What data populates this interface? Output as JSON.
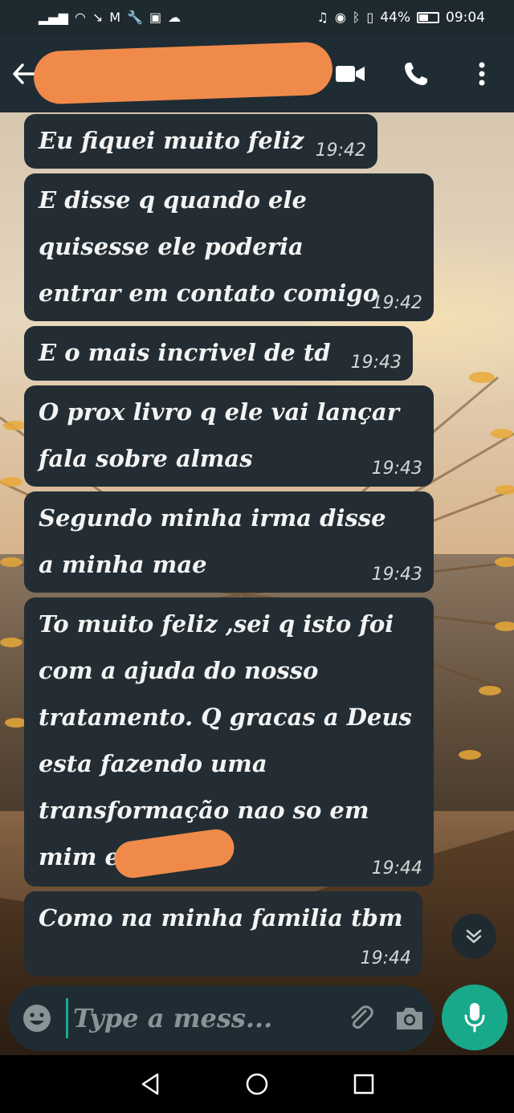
{
  "status_bar": {
    "battery_percent": "44%",
    "battery_level": 0.44,
    "time": "09:04"
  },
  "header": {
    "contact_name": "",
    "icons": {
      "back": "back-arrow-icon",
      "video": "video-call-icon",
      "call": "phone-call-icon",
      "menu": "more-options-icon"
    }
  },
  "messages": [
    {
      "text": "Eu fiquei muito feliz",
      "time": "19:42"
    },
    {
      "text": "E disse q quando ele quisesse ele poderia entrar em contato comigo sim",
      "time": "19:42"
    },
    {
      "text": "E o mais incrivel de td",
      "time": "19:43"
    },
    {
      "text": "O prox livro q ele vai lançar fala sobre almas",
      "time": "19:43"
    },
    {
      "text": "Segundo minha irma disse a minha mae",
      "time": "19:43"
    },
    {
      "text": "To muito feliz ,sei q isto foi com a ajuda do nosso tratamento. Q gracas a Deus esta fazendo uma transformação nao so em mim e",
      "time": "19:44"
    },
    {
      "text": "Como na minha familia tbm",
      "time": "19:44"
    }
  ],
  "composer": {
    "placeholder": "Type a mess..."
  },
  "colors": {
    "header_bg": "#1f2c33",
    "bubble_bg": "#232d33",
    "accent_green": "#18a88a",
    "redaction": "#f08a4b"
  }
}
